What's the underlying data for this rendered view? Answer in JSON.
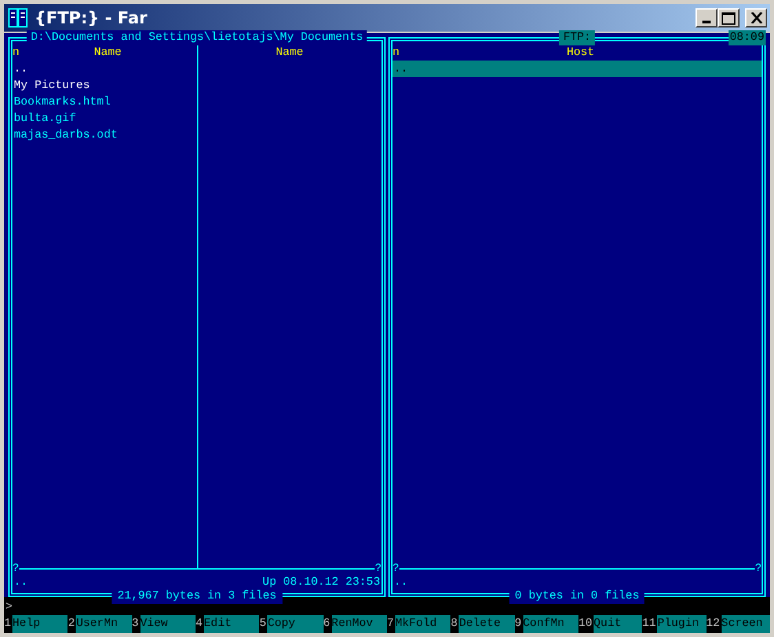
{
  "window": {
    "title": "{FTP:} - Far"
  },
  "panels": [
    {
      "title": "D:\\Documents and Settings\\lietotajs\\My Documents",
      "active": false,
      "sort_mark": "n",
      "junction_glyph": "?",
      "columns": [
        "Name",
        "Name"
      ],
      "items": [
        {
          "name": "..",
          "kind": "folder",
          "selected": false
        },
        {
          "name": "My Pictures",
          "kind": "folder",
          "selected": false
        },
        {
          "name": "Bookmarks.html",
          "kind": "file",
          "selected": false
        },
        {
          "name": "bulta.gif",
          "kind": "file",
          "selected": false
        },
        {
          "name": "majas_darbs.odt",
          "kind": "file",
          "selected": false
        }
      ],
      "info": {
        "name": "..",
        "type": "Up",
        "date": "08.10.12 23:53"
      },
      "summary": "21,967 bytes in 3 files"
    },
    {
      "title": "FTP:",
      "active": true,
      "clock": "08:09",
      "sort_mark": "n",
      "junction_glyph": "?",
      "columns": [
        "Host"
      ],
      "items": [
        {
          "name": "..",
          "kind": "folder",
          "selected": true
        }
      ],
      "info": {
        "name": ".."
      },
      "summary": "0 bytes in 0 files"
    }
  ],
  "command_line": {
    "prompt": ">"
  },
  "key_bar": [
    {
      "number": "1",
      "label": "Help"
    },
    {
      "number": "2",
      "label": "UserMn"
    },
    {
      "number": "3",
      "label": "View"
    },
    {
      "number": "4",
      "label": "Edit"
    },
    {
      "number": "5",
      "label": "Copy"
    },
    {
      "number": "6",
      "label": "RenMov"
    },
    {
      "number": "7",
      "label": "MkFold"
    },
    {
      "number": "8",
      "label": "Delete"
    },
    {
      "number": "9",
      "label": "ConfMn"
    },
    {
      "number": "10",
      "label": "Quit"
    },
    {
      "number": "11",
      "label": "Plugin"
    },
    {
      "number": "12",
      "label": "Screen"
    }
  ]
}
